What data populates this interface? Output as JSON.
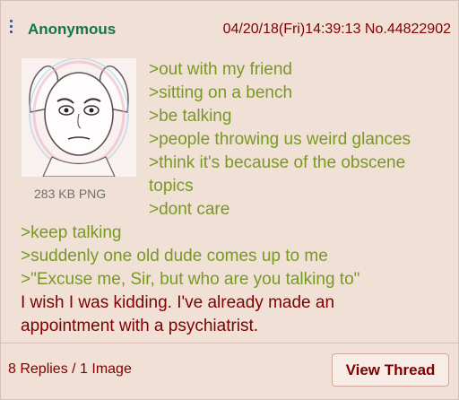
{
  "post": {
    "name": "Anonymous",
    "meta": "04/20/18(Fri)14:39:13 No.44822902",
    "file_info": "283 KB PNG",
    "lines": [
      ">out with my friend",
      ">sitting on a bench",
      ">be talking",
      ">people throwing us weird glances",
      ">think it's because of the obscene",
      "topics",
      ">dont care",
      ">keep talking",
      ">suddenly one old dude comes up to me",
      ">\"Excuse me, Sir, but who are you talking to\"",
      "I wish I was kidding. I've already made an",
      "appointment with a psychiatrist."
    ]
  },
  "footer": {
    "replies": "8 Replies / 1 Image",
    "view_button": "View Thread"
  },
  "colors": {
    "name": "#117743",
    "greentext": "#789922",
    "text": "#800000",
    "background": "#f0e0d6"
  },
  "icons": {
    "menu": "vertical-dots-icon",
    "thumbnail": "wojak-face-thumbnail"
  }
}
